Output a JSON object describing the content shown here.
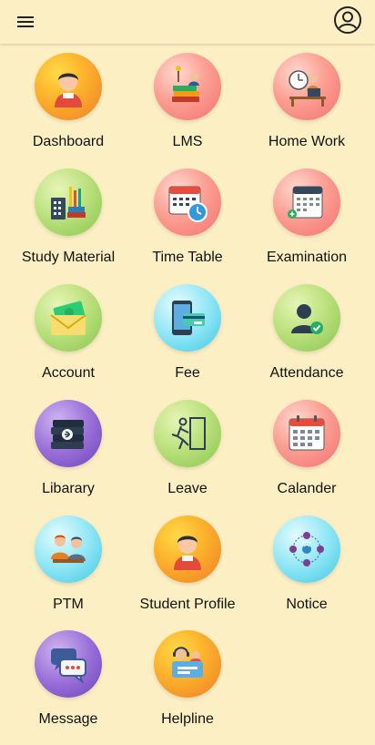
{
  "appbar": {
    "title": ""
  },
  "tiles": [
    {
      "label": "Dashboard",
      "icon": "student-avatar-icon"
    },
    {
      "label": "LMS",
      "icon": "books-learning-icon"
    },
    {
      "label": "Home Work",
      "icon": "home-work-desk-icon"
    },
    {
      "label": "Study Material",
      "icon": "study-material-books-icon"
    },
    {
      "label": "Time Table",
      "icon": "calendar-clock-icon"
    },
    {
      "label": "Examination",
      "icon": "exam-calendar-icon"
    },
    {
      "label": "Account",
      "icon": "money-envelope-icon"
    },
    {
      "label": "Fee",
      "icon": "mobile-pay-icon"
    },
    {
      "label": "Attendance",
      "icon": "user-check-icon"
    },
    {
      "label": "Libarary",
      "icon": "ebook-stack-icon"
    },
    {
      "label": "Leave",
      "icon": "exit-door-icon"
    },
    {
      "label": "Calander",
      "icon": "calendar-icon"
    },
    {
      "label": "PTM",
      "icon": "parent-teacher-meeting-icon"
    },
    {
      "label": "Student Profile",
      "icon": "student-avatar-icon"
    },
    {
      "label": "Notice",
      "icon": "network-notice-icon"
    },
    {
      "label": "Message",
      "icon": "chat-bubbles-icon"
    },
    {
      "label": "Helpline",
      "icon": "helpline-support-icon"
    }
  ]
}
